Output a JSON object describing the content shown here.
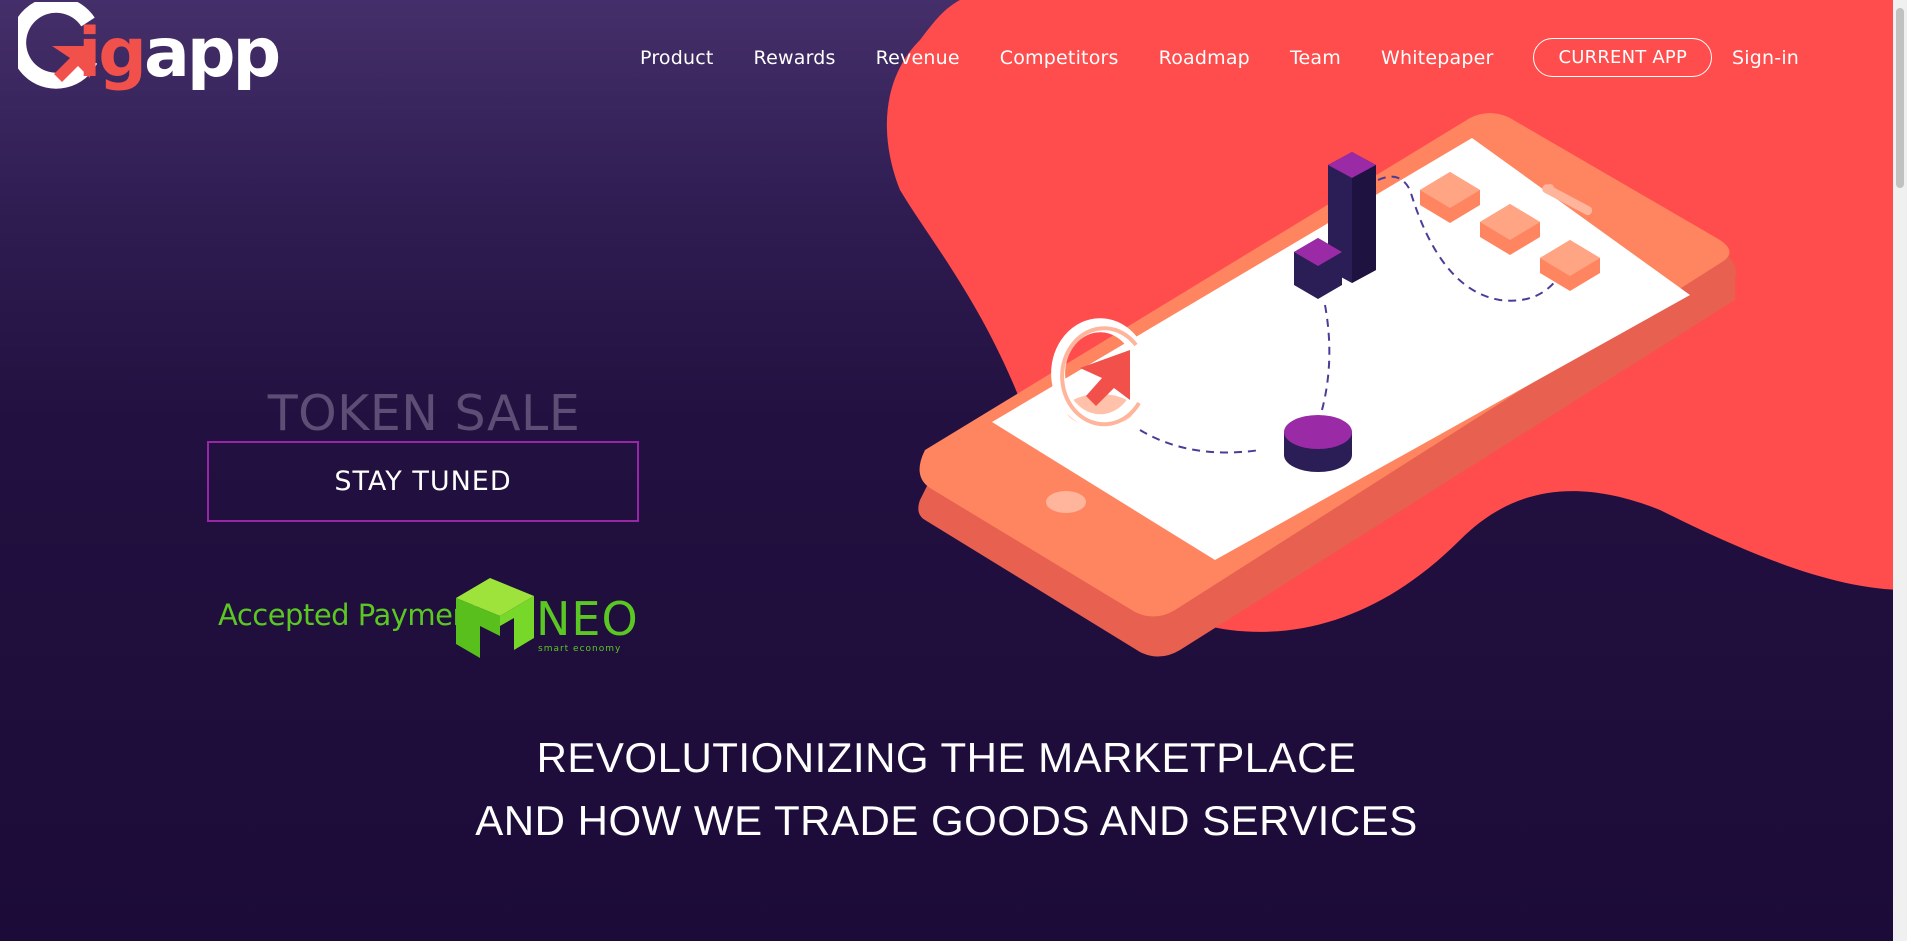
{
  "logo": {
    "g": "G",
    "ig": "ig",
    "app": "app"
  },
  "nav": {
    "items": [
      "Product",
      "Rewards",
      "Revenue",
      "Competitors",
      "Roadmap",
      "Team",
      "Whitepaper"
    ],
    "cta": "CURRENT APP",
    "signin": "Sign-in"
  },
  "hero": {
    "token_sale": "TOKEN SALE",
    "stay_tuned": "STAY TUNED"
  },
  "payment": {
    "label": "Accepted Payment",
    "neo": "NEO",
    "neo_sub": "smart economy"
  },
  "headline": {
    "line1": "REVOLUTIONIZING THE MARKETPLACE",
    "line2": "AND HOW WE TRADE GOODS AND SERVICES"
  },
  "colors": {
    "brand_red": "#f2504b",
    "accent_purple": "#9727a6",
    "neo_green": "#5ac723",
    "bg_dark": "#1c0b38"
  },
  "icons": [
    "gigapp-logo",
    "neo-logo-icon",
    "phone-illustration"
  ]
}
